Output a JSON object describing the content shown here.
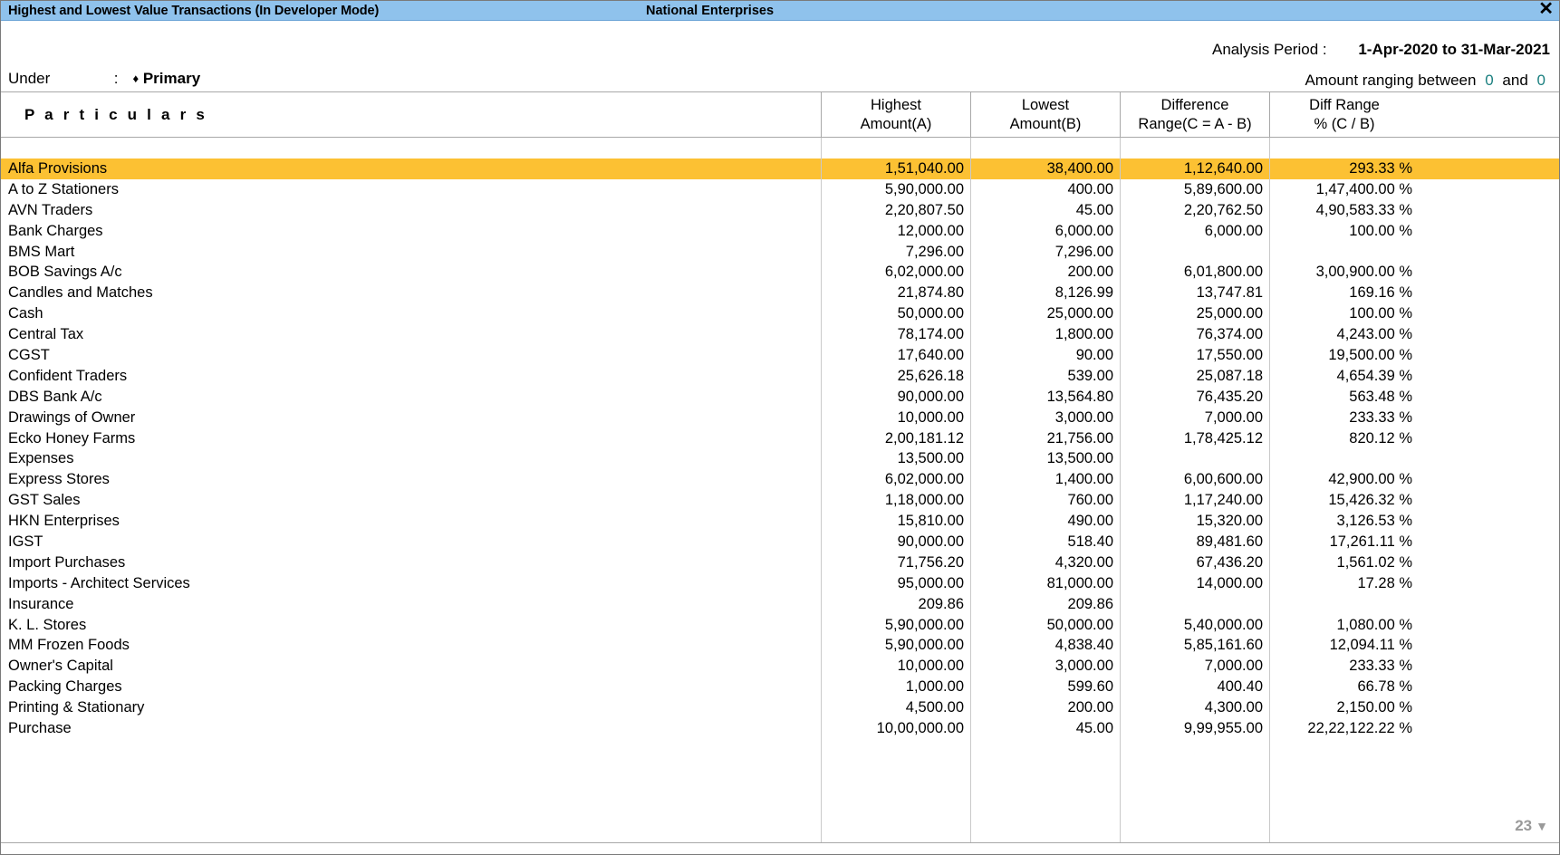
{
  "titlebar": {
    "title": "Highest and Lowest Value Transactions (In Developer Mode)",
    "company": "National Enterprises",
    "close_label": "✕"
  },
  "header": {
    "analysis_period_label": "Analysis Period :",
    "analysis_period_value": "1-Apr-2020 to 31-Mar-2021",
    "under_label": "Under",
    "under_colon": ":",
    "under_diamond": "♦",
    "under_value": "Primary",
    "ranging_label": "Amount ranging between",
    "ranging_from": "0",
    "ranging_and": "and",
    "ranging_to": "0"
  },
  "table": {
    "columns": {
      "particulars": "P a r t i c u l a r s",
      "highest_line1": "Highest",
      "highest_line2": "Amount(A)",
      "lowest_line1": "Lowest",
      "lowest_line2": "Amount(B)",
      "difference_line1": "Difference",
      "difference_line2": "Range(C = A - B)",
      "diffrange_line1": "Diff Range",
      "diffrange_line2": "% (C / B)"
    },
    "selected_index": 0,
    "rows": [
      {
        "particulars": "Alfa Provisions",
        "highest": "1,51,040.00",
        "lowest": "38,400.00",
        "difference": "1,12,640.00",
        "diff_pct": "293.33 %"
      },
      {
        "particulars": "A to Z Stationers",
        "highest": "5,90,000.00",
        "lowest": "400.00",
        "difference": "5,89,600.00",
        "diff_pct": "1,47,400.00 %"
      },
      {
        "particulars": "AVN Traders",
        "highest": "2,20,807.50",
        "lowest": "45.00",
        "difference": "2,20,762.50",
        "diff_pct": "4,90,583.33 %"
      },
      {
        "particulars": "Bank Charges",
        "highest": "12,000.00",
        "lowest": "6,000.00",
        "difference": "6,000.00",
        "diff_pct": "100.00 %"
      },
      {
        "particulars": "BMS Mart",
        "highest": "7,296.00",
        "lowest": "7,296.00",
        "difference": "",
        "diff_pct": ""
      },
      {
        "particulars": "BOB Savings A/c",
        "highest": "6,02,000.00",
        "lowest": "200.00",
        "difference": "6,01,800.00",
        "diff_pct": "3,00,900.00 %"
      },
      {
        "particulars": "Candles and Matches",
        "highest": "21,874.80",
        "lowest": "8,126.99",
        "difference": "13,747.81",
        "diff_pct": "169.16 %"
      },
      {
        "particulars": "Cash",
        "highest": "50,000.00",
        "lowest": "25,000.00",
        "difference": "25,000.00",
        "diff_pct": "100.00 %"
      },
      {
        "particulars": "Central Tax",
        "highest": "78,174.00",
        "lowest": "1,800.00",
        "difference": "76,374.00",
        "diff_pct": "4,243.00 %"
      },
      {
        "particulars": "CGST",
        "highest": "17,640.00",
        "lowest": "90.00",
        "difference": "17,550.00",
        "diff_pct": "19,500.00 %"
      },
      {
        "particulars": "Confident Traders",
        "highest": "25,626.18",
        "lowest": "539.00",
        "difference": "25,087.18",
        "diff_pct": "4,654.39 %"
      },
      {
        "particulars": "DBS Bank A/c",
        "highest": "90,000.00",
        "lowest": "13,564.80",
        "difference": "76,435.20",
        "diff_pct": "563.48 %"
      },
      {
        "particulars": "Drawings of Owner",
        "highest": "10,000.00",
        "lowest": "3,000.00",
        "difference": "7,000.00",
        "diff_pct": "233.33 %"
      },
      {
        "particulars": "Ecko Honey Farms",
        "highest": "2,00,181.12",
        "lowest": "21,756.00",
        "difference": "1,78,425.12",
        "diff_pct": "820.12 %"
      },
      {
        "particulars": "Expenses",
        "highest": "13,500.00",
        "lowest": "13,500.00",
        "difference": "",
        "diff_pct": ""
      },
      {
        "particulars": "Express Stores",
        "highest": "6,02,000.00",
        "lowest": "1,400.00",
        "difference": "6,00,600.00",
        "diff_pct": "42,900.00 %"
      },
      {
        "particulars": "GST Sales",
        "highest": "1,18,000.00",
        "lowest": "760.00",
        "difference": "1,17,240.00",
        "diff_pct": "15,426.32 %"
      },
      {
        "particulars": "HKN Enterprises",
        "highest": "15,810.00",
        "lowest": "490.00",
        "difference": "15,320.00",
        "diff_pct": "3,126.53 %"
      },
      {
        "particulars": "IGST",
        "highest": "90,000.00",
        "lowest": "518.40",
        "difference": "89,481.60",
        "diff_pct": "17,261.11 %"
      },
      {
        "particulars": "Import Purchases",
        "highest": "71,756.20",
        "lowest": "4,320.00",
        "difference": "67,436.20",
        "diff_pct": "1,561.02 %"
      },
      {
        "particulars": "Imports - Architect Services",
        "highest": "95,000.00",
        "lowest": "81,000.00",
        "difference": "14,000.00",
        "diff_pct": "17.28 %"
      },
      {
        "particulars": "Insurance",
        "highest": "209.86",
        "lowest": "209.86",
        "difference": "",
        "diff_pct": ""
      },
      {
        "particulars": "K. L. Stores",
        "highest": "5,90,000.00",
        "lowest": "50,000.00",
        "difference": "5,40,000.00",
        "diff_pct": "1,080.00 %"
      },
      {
        "particulars": "MM Frozen Foods",
        "highest": "5,90,000.00",
        "lowest": "4,838.40",
        "difference": "5,85,161.60",
        "diff_pct": "12,094.11 %"
      },
      {
        "particulars": "Owner's Capital",
        "highest": "10,000.00",
        "lowest": "3,000.00",
        "difference": "7,000.00",
        "diff_pct": "233.33 %"
      },
      {
        "particulars": "Packing Charges",
        "highest": "1,000.00",
        "lowest": "599.60",
        "difference": "400.40",
        "diff_pct": "66.78 %"
      },
      {
        "particulars": "Printing & Stationary",
        "highest": "4,500.00",
        "lowest": "200.00",
        "difference": "4,300.00",
        "diff_pct": "2,150.00 %"
      },
      {
        "particulars": "Purchase",
        "highest": "10,00,000.00",
        "lowest": "45.00",
        "difference": "9,99,955.00",
        "diff_pct": "22,22,122.22 %"
      }
    ]
  },
  "footer": {
    "page_count": "23",
    "scroll_caret": "▼"
  },
  "colors": {
    "titlebar": "#8fc2ec",
    "selection": "#fcc133",
    "teal_value": "#1a7f7f",
    "grid_line": "#c9c9c9"
  }
}
